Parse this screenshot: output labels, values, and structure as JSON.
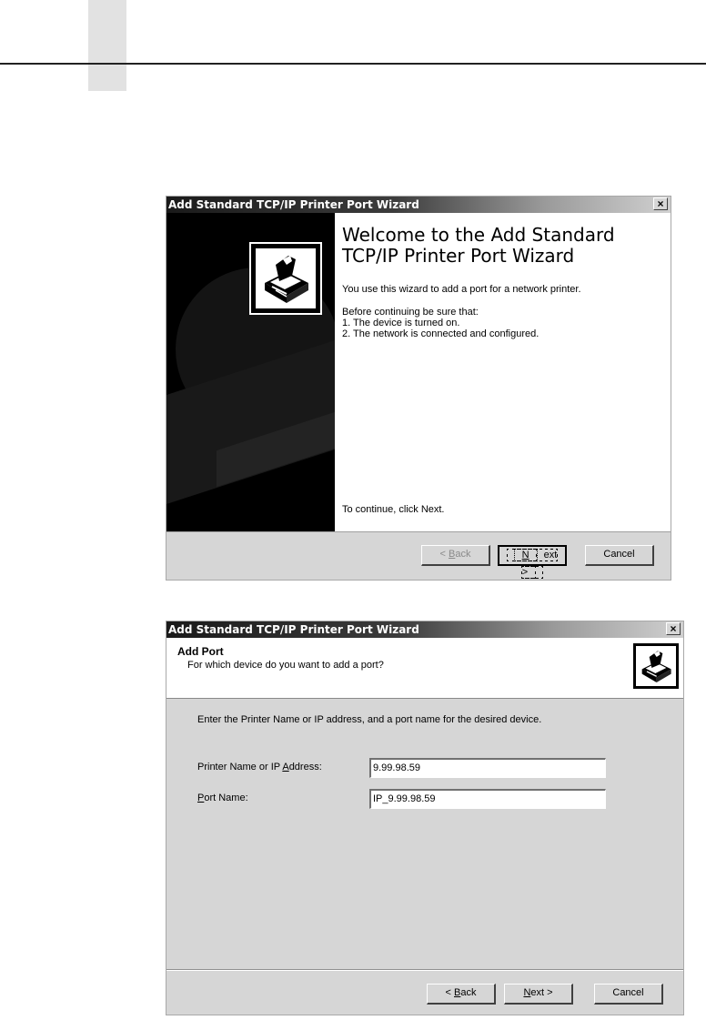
{
  "wizard1": {
    "title": "Add Standard TCP/IP Printer Port Wizard",
    "close_label": "×",
    "heading_line1": "Welcome to the Add Standard",
    "heading_line2": "TCP/IP Printer Port Wizard",
    "intro": "You use this wizard to add a port for a network printer.",
    "before": "Before continuing be sure that:",
    "item1": "1.  The device is turned on.",
    "item2": "2.  The network is connected and configured.",
    "continue": "To continue, click Next.",
    "icon": "printer-icon",
    "buttons": {
      "back": {
        "prefix": "< ",
        "mnemonic": "B",
        "rest": "ack",
        "enabled": false
      },
      "next": {
        "mnemonic": "N",
        "rest": "ext >",
        "default": true
      },
      "cancel": "Cancel"
    }
  },
  "wizard2": {
    "title": "Add Standard TCP/IP Printer Port Wizard",
    "close_label": "×",
    "header_title": "Add Port",
    "header_subtitle": "For which device do you want to add a port?",
    "icon": "printer-icon",
    "instruction": "Enter the Printer Name or IP address, and a port name for the desired device.",
    "printer_label": {
      "prefix": "Printer Name or IP ",
      "mnemonic": "A",
      "rest": "ddress:"
    },
    "printer_value": "9.99.98.59",
    "port_label": {
      "mnemonic": "P",
      "rest": "ort Name:"
    },
    "port_value": "IP_9.99.98.59",
    "buttons": {
      "back": {
        "prefix": "< ",
        "mnemonic": "B",
        "rest": "ack",
        "enabled": true
      },
      "next": {
        "mnemonic": "N",
        "rest": "ext >"
      },
      "cancel": "Cancel"
    }
  }
}
